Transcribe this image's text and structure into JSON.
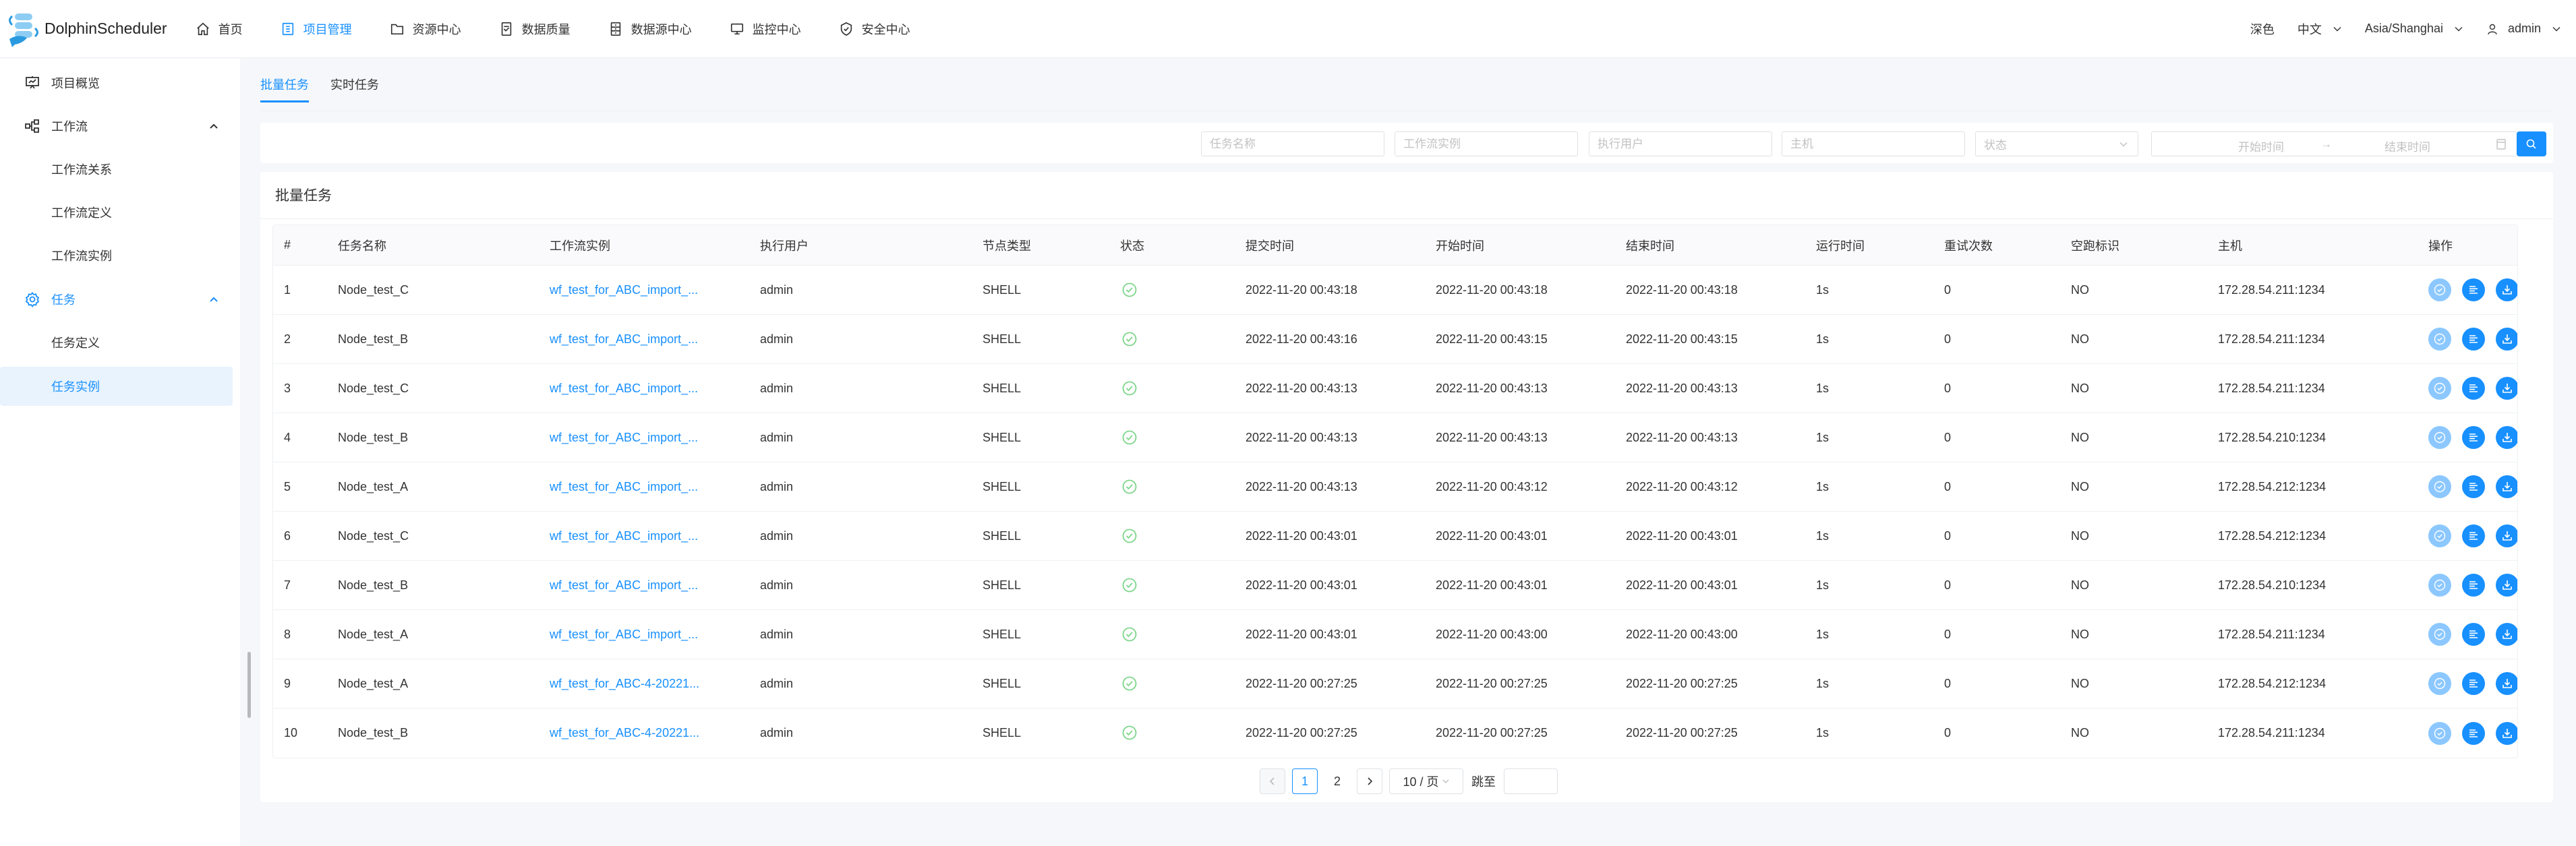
{
  "header": {
    "app_name": "DolphinScheduler",
    "nav": [
      {
        "label": "首页",
        "icon": "home-icon"
      },
      {
        "label": "项目管理",
        "icon": "project-icon",
        "active": true
      },
      {
        "label": "资源中心",
        "icon": "folder-icon"
      },
      {
        "label": "数据质量",
        "icon": "data-quality-icon"
      },
      {
        "label": "数据源中心",
        "icon": "datasource-icon"
      },
      {
        "label": "监控中心",
        "icon": "monitor-icon"
      },
      {
        "label": "安全中心",
        "icon": "shield-icon"
      }
    ],
    "theme_label": "深色",
    "language": "中文",
    "timezone": "Asia/Shanghai",
    "user": "admin"
  },
  "sidebar": {
    "items": [
      {
        "label": "项目概览",
        "icon": "presentation-chart-icon"
      },
      {
        "label": "工作流",
        "icon": "workflow-icon",
        "expanded": true
      },
      {
        "label": "工作流关系"
      },
      {
        "label": "工作流定义"
      },
      {
        "label": "工作流实例"
      },
      {
        "label": "任务",
        "icon": "gear-icon",
        "expanded": true,
        "active": true
      },
      {
        "label": "任务定义"
      },
      {
        "label": "任务实例",
        "selected": true
      }
    ]
  },
  "tabs": [
    {
      "label": "批量任务",
      "active": true
    },
    {
      "label": "实时任务"
    }
  ],
  "filters": {
    "task_name_placeholder": "任务名称",
    "workflow_instance_placeholder": "工作流实例",
    "executor_placeholder": "执行用户",
    "host_placeholder": "主机",
    "state_placeholder": "状态",
    "start_time_placeholder": "开始时间",
    "end_time_placeholder": "结束时间",
    "range_separator": "→"
  },
  "table": {
    "title": "批量任务",
    "columns": [
      "#",
      "任务名称",
      "工作流实例",
      "执行用户",
      "节点类型",
      "状态",
      "提交时间",
      "开始时间",
      "结束时间",
      "运行时间",
      "重试次数",
      "空跑标识",
      "主机",
      "操作"
    ],
    "rows": [
      {
        "id": "1",
        "name": "Node_test_C",
        "workflow": "wf_test_for_ABC_import_...",
        "user": "admin",
        "type": "SHELL",
        "status": "success",
        "submit": "2022-11-20 00:43:18",
        "start": "2022-11-20 00:43:18",
        "end": "2022-11-20 00:43:18",
        "duration": "1s",
        "retries": "0",
        "dry_run": "NO",
        "host": "172.28.54.211:1234"
      },
      {
        "id": "2",
        "name": "Node_test_B",
        "workflow": "wf_test_for_ABC_import_...",
        "user": "admin",
        "type": "SHELL",
        "status": "success",
        "submit": "2022-11-20 00:43:16",
        "start": "2022-11-20 00:43:15",
        "end": "2022-11-20 00:43:15",
        "duration": "1s",
        "retries": "0",
        "dry_run": "NO",
        "host": "172.28.54.211:1234"
      },
      {
        "id": "3",
        "name": "Node_test_C",
        "workflow": "wf_test_for_ABC_import_...",
        "user": "admin",
        "type": "SHELL",
        "status": "success",
        "submit": "2022-11-20 00:43:13",
        "start": "2022-11-20 00:43:13",
        "end": "2022-11-20 00:43:13",
        "duration": "1s",
        "retries": "0",
        "dry_run": "NO",
        "host": "172.28.54.211:1234"
      },
      {
        "id": "4",
        "name": "Node_test_B",
        "workflow": "wf_test_for_ABC_import_...",
        "user": "admin",
        "type": "SHELL",
        "status": "success",
        "submit": "2022-11-20 00:43:13",
        "start": "2022-11-20 00:43:13",
        "end": "2022-11-20 00:43:13",
        "duration": "1s",
        "retries": "0",
        "dry_run": "NO",
        "host": "172.28.54.210:1234"
      },
      {
        "id": "5",
        "name": "Node_test_A",
        "workflow": "wf_test_for_ABC_import_...",
        "user": "admin",
        "type": "SHELL",
        "status": "success",
        "submit": "2022-11-20 00:43:13",
        "start": "2022-11-20 00:43:12",
        "end": "2022-11-20 00:43:12",
        "duration": "1s",
        "retries": "0",
        "dry_run": "NO",
        "host": "172.28.54.212:1234"
      },
      {
        "id": "6",
        "name": "Node_test_C",
        "workflow": "wf_test_for_ABC_import_...",
        "user": "admin",
        "type": "SHELL",
        "status": "success",
        "submit": "2022-11-20 00:43:01",
        "start": "2022-11-20 00:43:01",
        "end": "2022-11-20 00:43:01",
        "duration": "1s",
        "retries": "0",
        "dry_run": "NO",
        "host": "172.28.54.212:1234"
      },
      {
        "id": "7",
        "name": "Node_test_B",
        "workflow": "wf_test_for_ABC_import_...",
        "user": "admin",
        "type": "SHELL",
        "status": "success",
        "submit": "2022-11-20 00:43:01",
        "start": "2022-11-20 00:43:01",
        "end": "2022-11-20 00:43:01",
        "duration": "1s",
        "retries": "0",
        "dry_run": "NO",
        "host": "172.28.54.210:1234"
      },
      {
        "id": "8",
        "name": "Node_test_A",
        "workflow": "wf_test_for_ABC_import_...",
        "user": "admin",
        "type": "SHELL",
        "status": "success",
        "submit": "2022-11-20 00:43:01",
        "start": "2022-11-20 00:43:00",
        "end": "2022-11-20 00:43:00",
        "duration": "1s",
        "retries": "0",
        "dry_run": "NO",
        "host": "172.28.54.211:1234"
      },
      {
        "id": "9",
        "name": "Node_test_A",
        "workflow": "wf_test_for_ABC-4-20221...",
        "user": "admin",
        "type": "SHELL",
        "status": "success",
        "submit": "2022-11-20 00:27:25",
        "start": "2022-11-20 00:27:25",
        "end": "2022-11-20 00:27:25",
        "duration": "1s",
        "retries": "0",
        "dry_run": "NO",
        "host": "172.28.54.212:1234"
      },
      {
        "id": "10",
        "name": "Node_test_B",
        "workflow": "wf_test_for_ABC-4-20221...",
        "user": "admin",
        "type": "SHELL",
        "status": "success",
        "submit": "2022-11-20 00:27:25",
        "start": "2022-11-20 00:27:25",
        "end": "2022-11-20 00:27:25",
        "duration": "1s",
        "retries": "0",
        "dry_run": "NO",
        "host": "172.28.54.211:1234"
      }
    ],
    "row_actions": [
      {
        "icon": "check-circle-icon",
        "name": "force-success-button",
        "disabled": true
      },
      {
        "icon": "log-lines-icon",
        "name": "view-log-button"
      },
      {
        "icon": "download-icon",
        "name": "download-log-button"
      }
    ]
  },
  "pagination": {
    "pages": [
      "1",
      "2"
    ],
    "current": "1",
    "page_size": "10 / 页",
    "jump_label": "跳至",
    "jump_value": ""
  },
  "colors": {
    "primary": "#1890ff",
    "primary_light": "#8cc8ff",
    "success": "#7ed58a",
    "selected_bg": "#e8f3fe"
  }
}
